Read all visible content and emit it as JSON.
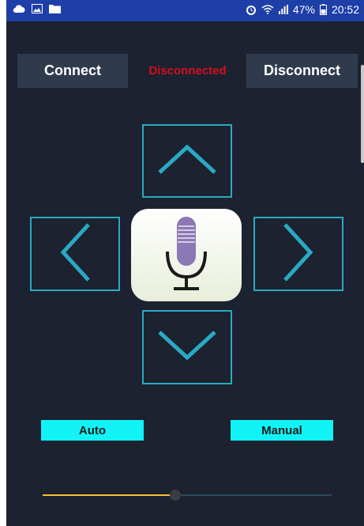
{
  "status_bar": {
    "battery_percent": "47%",
    "time": "20:52",
    "left_icons": [
      "cloud-icon",
      "image-icon",
      "folder-icon"
    ],
    "right_icons": [
      "alarm-icon",
      "wifi-icon",
      "signal-icon",
      "battery-icon"
    ]
  },
  "controls": {
    "connect_label": "Connect",
    "disconnect_label": "Disconnect",
    "connection_status": "Disconnected",
    "status_color": "#d50f1a"
  },
  "dpad": {
    "up": "chevron-up-icon",
    "down": "chevron-down-icon",
    "left": "chevron-left-icon",
    "right": "chevron-right-icon",
    "center": "microphone-icon",
    "accent": "#2aa9c2"
  },
  "modes": {
    "auto_label": "Auto",
    "manual_label": "Manual",
    "button_color": "#11f3f7"
  },
  "slider": {
    "value_fraction": 0.46,
    "fill_color": "#f2c230"
  }
}
